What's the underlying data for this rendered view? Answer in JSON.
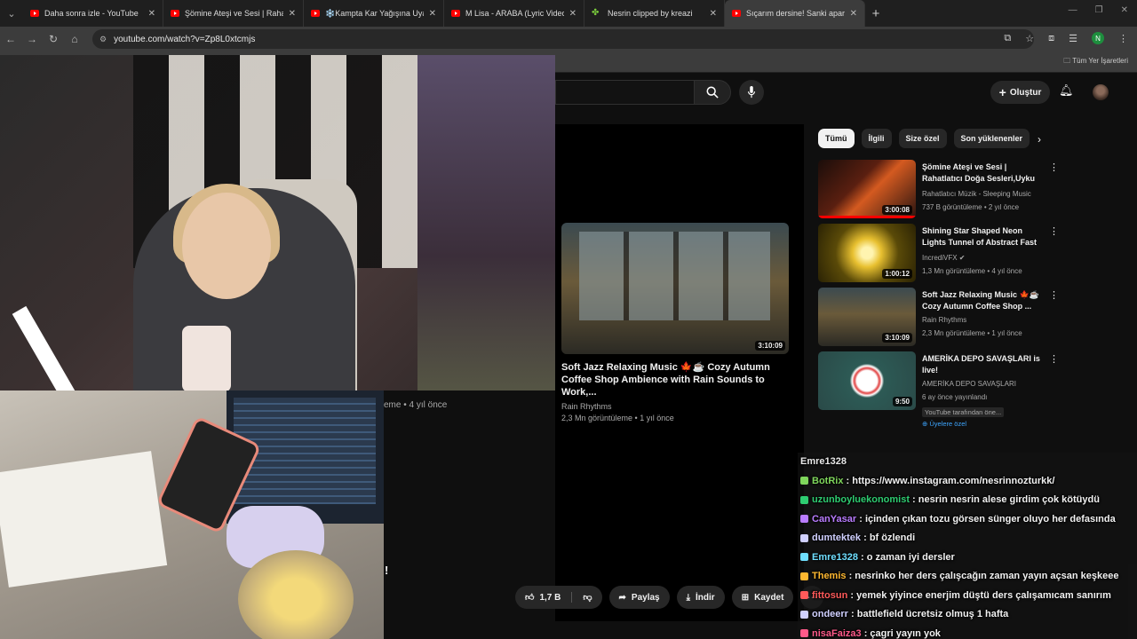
{
  "tabs": [
    {
      "title": "Daha sonra izle - YouTube",
      "type": "youtube"
    },
    {
      "title": "Şömine Ateşi ve Sesi | Rahatlatı",
      "type": "youtube"
    },
    {
      "title": "❄️Kampta Kar Yağışına Uyandı",
      "type": "youtube"
    },
    {
      "title": "M Lisa - ARABA (Lyric Video) - Y",
      "type": "youtube"
    },
    {
      "title": "Nesrin clipped by kreazi",
      "type": "clip"
    },
    {
      "title": "Sıçarım dersine! Sanki apartma",
      "type": "youtube",
      "active": true
    }
  ],
  "address": {
    "url": "youtube.com/watch?v=Zp8L0xtcmjs",
    "profile_initial": "N"
  },
  "bookmarks": {
    "all_label": "Tüm Yer İşaretleri"
  },
  "header": {
    "create_label": "Oluştur"
  },
  "player": {
    "meta_fragment": "eme • 4 yıl önce",
    "exclaim": "!",
    "like_count": "1,7 B",
    "share_label": "Paylaş",
    "download_label": "İndir",
    "save_label": "Kaydet"
  },
  "featured_rec": {
    "title": "Soft Jazz Relaxing Music 🍁☕ Cozy Autumn Coffee Shop Ambience with Rain Sounds to Work,...",
    "channel": "Rain Rhythms",
    "stats": "2,3 Mn görüntüleme • 1 yıl önce",
    "duration": "3:10:09"
  },
  "chips": [
    "Tümü",
    "İlgili",
    "Size özel",
    "Son yüklenenler"
  ],
  "sidebar": [
    {
      "title": "Şömine Ateşi ve Sesi | Rahatlatıcı Doğa Sesleri,Uyku ...",
      "channel": "Rahatlatıcı Müzik - Sleeping Music",
      "stats": "737 B görüntüleme • 2 yıl önce",
      "duration": "3:00:08",
      "progress": 1.0
    },
    {
      "title": "Shining Star Shaped Neon Lights Tunnel of Abstract Fast ...",
      "channel": "IncrediVFX ✔",
      "stats": "1,3 Mn görüntüleme • 4 yıl önce",
      "duration": "1:00:12",
      "progress": 0.0
    },
    {
      "title": "Soft Jazz Relaxing Music 🍁☕ Cozy Autumn Coffee Shop ...",
      "channel": "Rain Rhythms",
      "stats": "2,3 Mn görüntüleme • 1 yıl önce",
      "duration": "3:10:09",
      "progress": 0.0
    },
    {
      "title": "AMERİKA DEPO SAVAŞLARI is live!",
      "channel": "AMERİKA DEPO SAVAŞLARI",
      "stats": "6 ay önce yayınlandı",
      "badge": "YouTube tarafından öne...",
      "members": "⊕ Üyelere özel",
      "duration": "9:50",
      "progress": 0.0
    }
  ],
  "chat": [
    {
      "user": "Emre1328",
      "color": "#e8e8e8",
      "msg": ""
    },
    {
      "user": "BotRix",
      "color": "#7fd65c",
      "msg": "https://www.instagram.com/nesrinnozturkk/"
    },
    {
      "user": "uzunboyluekonomist",
      "color": "#2ecc71",
      "msg": "nesrin nesrin alese girdim çok kötüydü"
    },
    {
      "user": "CanYasar",
      "color": "#b97cff",
      "msg": "içinden çıkan tozu görsen sünger oluyo her defasında"
    },
    {
      "user": "dumtektek",
      "color": "#d0d0ff",
      "msg": "bf özlendi"
    },
    {
      "user": "Emre1328",
      "color": "#6fdfff",
      "msg": "o zaman iyi dersler"
    },
    {
      "user": "Themis",
      "color": "#ffb830",
      "msg": "nesrinko her ders çalışcağın zaman yayın açsan keşkeee"
    },
    {
      "user": "fittosun",
      "color": "#ff5a5a",
      "msg": "yemek yiyince enerjim düştü ders çalışamıcam sanırım"
    },
    {
      "user": "ondeerr",
      "color": "#d0d0ff",
      "msg": "battlefield ücretsiz olmuş 1 hafta"
    },
    {
      "user": "nisaFaiza3",
      "color": "#ff5a8a",
      "msg": "çagri yayın yok"
    }
  ],
  "colors": {
    "accent": "#ff0000",
    "bg": "#0f0f0f"
  }
}
